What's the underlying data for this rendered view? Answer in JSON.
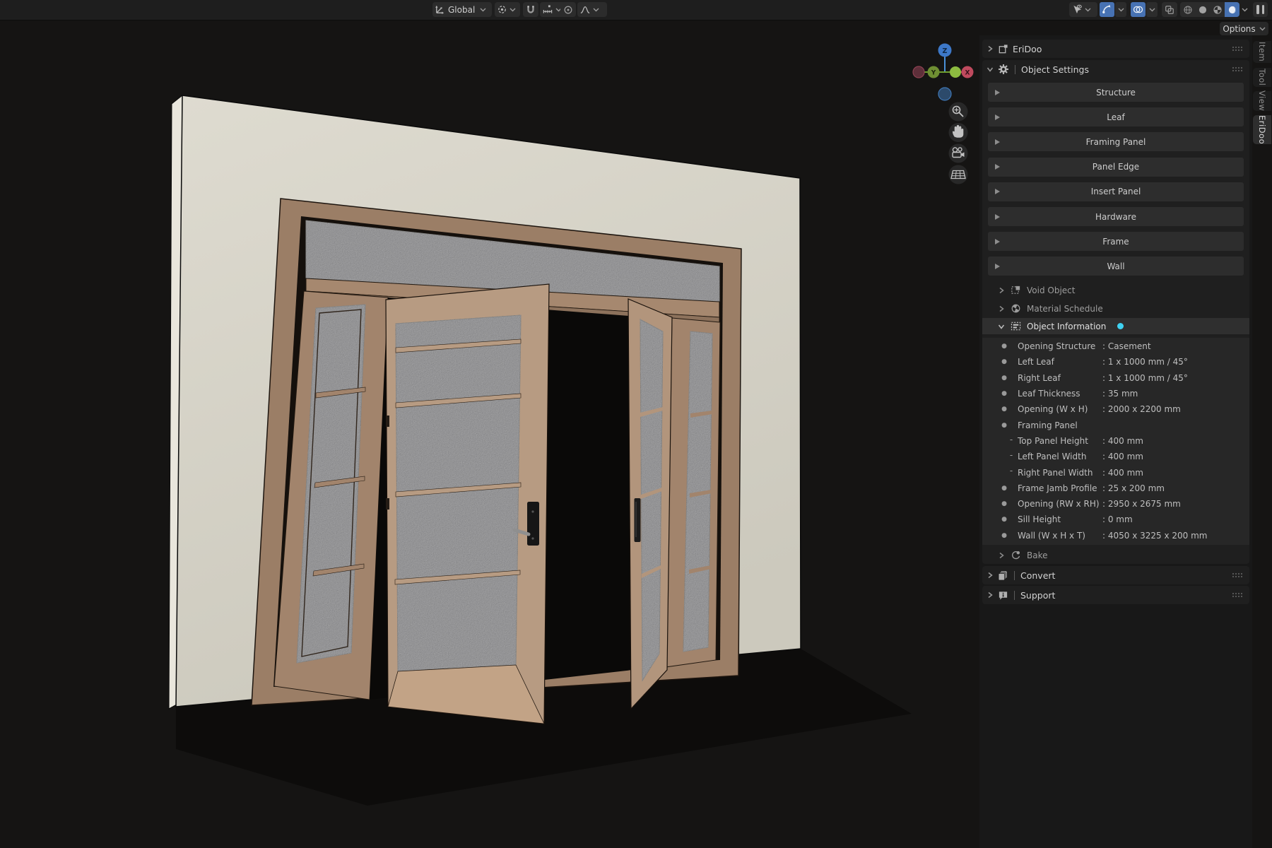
{
  "header": {
    "orientation": {
      "label": "Global"
    },
    "options_label": "Options",
    "icon_names": [
      "transform-orientation",
      "pivot-point",
      "snap-magnet",
      "snap-increment",
      "proportional-editing",
      "falloff-curve",
      "gizmo-visibility",
      "show-gizmos",
      "show-overlays",
      "toggle-xray",
      "shading-wireframe",
      "shading-solid",
      "shading-material",
      "shading-rendered",
      "pause"
    ],
    "active_toggles": [
      "show-gizmos",
      "show-overlays",
      "shading-rendered"
    ]
  },
  "viewport": {
    "gizmo_axes": {
      "x": "X",
      "y": "Y",
      "z": "Z"
    },
    "nav_buttons": [
      "zoom",
      "pan",
      "camera-view",
      "grid-floor"
    ]
  },
  "sidebar": {
    "tabs": [
      {
        "label": "Item"
      },
      {
        "label": "Tool"
      },
      {
        "label": "View"
      },
      {
        "label": "EriDoo",
        "active": true
      }
    ],
    "eridoo_panel": {
      "title": "EriDoo"
    },
    "object_settings": {
      "title": "Object Settings",
      "buttons": [
        "Structure",
        "Leaf",
        "Framing Panel",
        "Panel Edge",
        "Insert Panel",
        "Hardware",
        "Frame",
        "Wall"
      ],
      "void_object": "Void Object",
      "material_schedule": "Material Schedule",
      "object_information": "Object Information",
      "info_rows": [
        {
          "kind": "main",
          "marker": "●",
          "label": "Opening Structure",
          "value": ": Casement"
        },
        {
          "kind": "main",
          "marker": "●",
          "label": "Left Leaf",
          "value": ": 1 x 1000 mm / 45°"
        },
        {
          "kind": "main",
          "marker": "●",
          "label": "Right Leaf",
          "value": ": 1 x 1000 mm / 45°"
        },
        {
          "kind": "main",
          "marker": "●",
          "label": "Leaf Thickness",
          "value": ": 35 mm"
        },
        {
          "kind": "main",
          "marker": "●",
          "label": "Opening (W x H)",
          "value": ": 2000 x 2200 mm"
        },
        {
          "kind": "main",
          "marker": "●",
          "label": "Framing Panel",
          "value": ""
        },
        {
          "kind": "sub",
          "marker": "-",
          "label": "Top Panel Height",
          "value": ": 400 mm"
        },
        {
          "kind": "sub",
          "marker": "-",
          "label": "Left Panel Width",
          "value": ": 400 mm"
        },
        {
          "kind": "sub",
          "marker": "-",
          "label": "Right Panel Width",
          "value": ": 400 mm"
        },
        {
          "kind": "main",
          "marker": "●",
          "label": "Frame Jamb Profile",
          "value": ": 25 x 200 mm"
        },
        {
          "kind": "main",
          "marker": "●",
          "label": "Opening (RW x RH)",
          "value": ": 2950 x 2675 mm"
        },
        {
          "kind": "main",
          "marker": "●",
          "label": "Sill Height",
          "value": ": 0 mm"
        },
        {
          "kind": "main",
          "marker": "●",
          "label": "Wall (W x H x T)",
          "value": ": 4050 x 3225 x 200 mm"
        }
      ],
      "bake": "Bake"
    },
    "convert_panel": {
      "title": "Convert"
    },
    "support_panel": {
      "title": "Support"
    }
  },
  "colors": {
    "accent_blue": "#4772b3",
    "info_dot": "#3fd2f2",
    "wall": "#d9d6cb",
    "wood": "#a98b72",
    "glass": "#565659"
  }
}
